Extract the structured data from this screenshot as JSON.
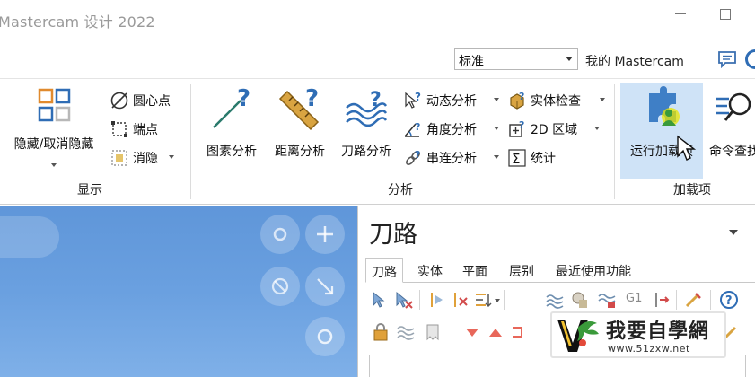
{
  "title_bar": {
    "app_title": "Mastercam 设计 2022"
  },
  "quickbar": {
    "style_value": "标准",
    "my_mastercam": "我的 Mastercam"
  },
  "ribbon": {
    "display_group": {
      "label": "显示",
      "hide_unhide": "隐藏/取消隐藏",
      "center_point": "圆心点",
      "endpoint": "端点",
      "blank": "消隐"
    },
    "analyze_group": {
      "label": "分析",
      "entity_analysis": "图素分析",
      "distance_analysis": "距离分析",
      "toolpath_analysis": "刀路分析",
      "dynamic_analysis": "动态分析",
      "angle_analysis": "角度分析",
      "chain_analysis": "串连分析",
      "solid_check": "实体检查",
      "area_2d": "2D 区域",
      "statistics": "统计"
    },
    "addins_group": {
      "label": "加载项",
      "run_addin": "运行加载项",
      "command_finder": "命令查找"
    }
  },
  "toolpath_panel": {
    "title": "刀路",
    "tabs": [
      "刀路",
      "实体",
      "平面",
      "层别",
      "最近使用功能"
    ],
    "active_tab": "刀路",
    "toolbar_text": "G1"
  },
  "watermark": {
    "text": "我要自學網",
    "url": "www.51zxw.net"
  },
  "colors": {
    "viewport_top": "#5f96d9",
    "addin_highlight": "#cfe3f7",
    "cursor_highlight": "#e8e600"
  }
}
